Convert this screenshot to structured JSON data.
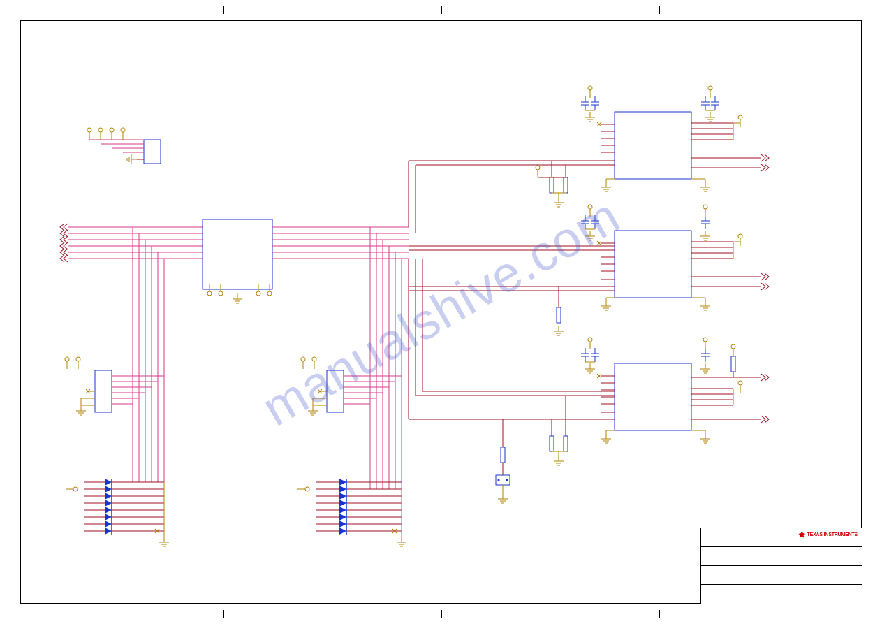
{
  "domain": "Diagram",
  "image": {
    "type": "electronic_schematic",
    "source_watermark": "manualshive.com",
    "manufacturer": "Texas Instruments"
  },
  "titleblock": {
    "logo_text": "TEXAS INSTRUMENTS",
    "rows": [
      "",
      "",
      "",
      ""
    ]
  },
  "schematic": {
    "sections": [
      {
        "name": "top-left-header",
        "approx_position": "upper-left",
        "components": [
          "small header / jumper block",
          "4 power-circle entries"
        ]
      },
      {
        "name": "left-bus-input",
        "approx_position": "mid-left",
        "components": [
          "6-line signal bus entering from left edge",
          "IC package (wide)",
          "power/gnd circles"
        ]
      },
      {
        "name": "header-block-1",
        "approx_position": "lower-left",
        "components": [
          "6-pin header",
          "power circles",
          "ground"
        ]
      },
      {
        "name": "header-block-2",
        "approx_position": "lower-center",
        "components": [
          "6-pin header",
          "power circles",
          "ground"
        ]
      },
      {
        "name": "diode-array-1",
        "approx_position": "bottom-left",
        "components": [
          "8× diodes in parallel ladder",
          "ground rail"
        ]
      },
      {
        "name": "diode-array-2",
        "approx_position": "bottom-center",
        "components": [
          "8× diodes in parallel ladder",
          "ground rail"
        ]
      },
      {
        "name": "right-ic-block-1",
        "approx_position": "upper-right",
        "components": [
          "IC package",
          "decoupling caps",
          "pull resistors",
          "output arrows"
        ]
      },
      {
        "name": "right-ic-block-2",
        "approx_position": "mid-right",
        "components": [
          "IC package",
          "decoupling caps",
          "pull resistor",
          "output arrows"
        ]
      },
      {
        "name": "right-ic-block-3",
        "approx_position": "lower-right",
        "components": [
          "IC package",
          "decoupling caps",
          "pull resistors",
          "output arrows"
        ]
      },
      {
        "name": "center-pulldown",
        "approx_position": "center-bottom",
        "components": [
          "resistor",
          "pushbutton/pad to ground"
        ]
      }
    ],
    "colors": {
      "component_outline": "#1a33cc",
      "wire_group_a": "#d63a8a",
      "wire_group_b": "#a01020",
      "power_gnd": "#b08000"
    }
  }
}
